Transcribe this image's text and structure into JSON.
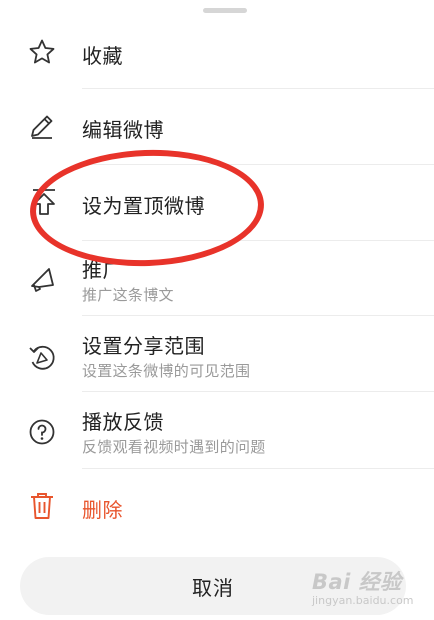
{
  "menu": {
    "items": [
      {
        "label": "收藏",
        "icon": "star-icon"
      },
      {
        "label": "编辑微博",
        "icon": "pencil-icon"
      },
      {
        "label": "设为置顶微博",
        "icon": "pin-top-icon"
      },
      {
        "label": "推广",
        "subtitle": "推广这条博文",
        "icon": "megaphone-icon"
      },
      {
        "label": "设置分享范围",
        "subtitle": "设置这条微博的可见范围",
        "icon": "share-scope-icon"
      },
      {
        "label": "播放反馈",
        "subtitle": "反馈观看视频时遇到的问题",
        "icon": "help-circle-icon"
      },
      {
        "label": "删除",
        "icon": "trash-icon"
      }
    ]
  },
  "cancel_label": "取消",
  "watermark": {
    "logo": "Bai 经验",
    "sub": "jingyan.baidu.com"
  },
  "colors": {
    "danger": "#e8552d",
    "annotation": "#e8332a",
    "text": "#222222",
    "subtext": "#9a9a9a"
  }
}
